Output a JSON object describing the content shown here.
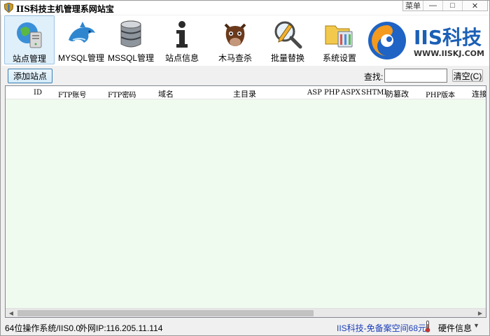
{
  "window": {
    "title": "IIS科技主机管理系网站宝",
    "controls": {
      "menu": "菜单",
      "minimize": "—",
      "maximize": "□",
      "close": "✕"
    }
  },
  "toolbar": {
    "items": [
      {
        "label": "站点管理",
        "icon": "globe-server-icon",
        "active": true
      },
      {
        "label": "MYSQL管理",
        "icon": "dolphin-icon",
        "active": false
      },
      {
        "label": "MSSQL管理",
        "icon": "database-icon",
        "active": false
      },
      {
        "label": "站点信息",
        "icon": "info-icon",
        "active": false
      },
      {
        "label": "木马查杀",
        "icon": "horse-icon",
        "active": false
      },
      {
        "label": "批量替换",
        "icon": "magnifier-pencil-icon",
        "active": false
      },
      {
        "label": "系统设置",
        "icon": "settings-folder-icon",
        "active": false
      }
    ]
  },
  "logo": {
    "brand": "IIS科技",
    "url": "WWW.IISKJ.COM"
  },
  "actions": {
    "add_site": "添加站点",
    "search_label": "查找:",
    "search_value": "",
    "clear": "清空(C)"
  },
  "table": {
    "columns": [
      "ID",
      "FTP账号",
      "FTP密码",
      "域名",
      "主目录",
      "ASP",
      "PHP",
      "ASPX",
      "SHTML",
      "防篡改",
      "PHP版本",
      "连接"
    ],
    "rows": []
  },
  "statusbar": {
    "os": "64位操作系统/IIS0.0",
    "ip": "外网IP:116.205.11.114",
    "promo": "IIS科技-免备案空间68元",
    "hardware": "硬件信息",
    "arrow": "▼"
  },
  "colors": {
    "accent": "#1b5fb6",
    "table_bg": "#f0fbef",
    "promo": "#1c3fb8"
  }
}
